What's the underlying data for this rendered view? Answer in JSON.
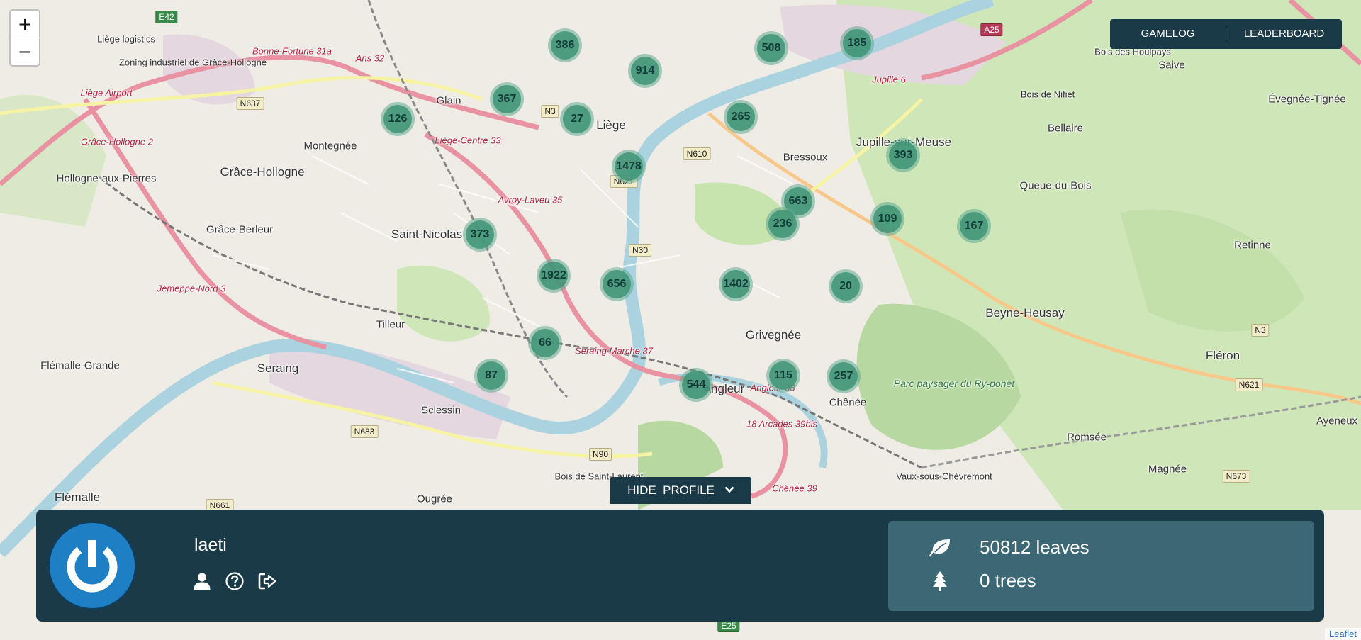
{
  "map": {
    "zoom_in_label": "+",
    "zoom_out_label": "−",
    "attribution": "Leaflet",
    "place_labels": [
      "Liège",
      "Saint-Nicolas",
      "Seraing",
      "Grâce-Hollogne",
      "Grâce-Berleur",
      "Montegnée",
      "Glain",
      "Tilleur",
      "Flémalle-Grande",
      "Flémalle",
      "Ougrée",
      "Sclessin",
      "Grivegnée",
      "Angleur",
      "Bressoux",
      "Jupille-sur-Meuse",
      "Beyne-Heusay",
      "Fléron",
      "Chênée",
      "Queue-du-Bois",
      "Bellaire",
      "Retinne",
      "Saive",
      "Évegnée-Tignée",
      "Romsée",
      "Magnée",
      "Vaux-sous-Chèvremont",
      "Hollogne-aux-Pierres",
      "Ayeneux",
      "Zoning industriel de Grâce-Hollogne",
      "Liège logistics",
      "Liège Airport",
      "Bois de Saint-Laurent",
      "Bois des Houlpays",
      "Bois de Nifiet"
    ],
    "exit_labels": [
      "Bonne-Fortune 31a",
      "Ans 32",
      "Liège-Centre 33",
      "Avroy-Laveu 35",
      "Jemeppe-Nord 3",
      "Seraing Marche 37",
      "Angleur 38",
      "18 Arcades 39bis",
      "Chênée 39",
      "Jupille 6",
      "Grâce-Hollogne 2"
    ],
    "park_label": "Parc paysager du Ry-ponet",
    "road_shields": [
      "E42",
      "N3",
      "N637",
      "N610",
      "N621",
      "N30",
      "N683",
      "N90",
      "N661",
      "E25",
      "A25",
      "N673",
      "N621",
      "N3"
    ],
    "clusters": [
      {
        "count": "386"
      },
      {
        "count": "914"
      },
      {
        "count": "508"
      },
      {
        "count": "185"
      },
      {
        "count": "367"
      },
      {
        "count": "27"
      },
      {
        "count": "126"
      },
      {
        "count": "265"
      },
      {
        "count": "1478"
      },
      {
        "count": "393"
      },
      {
        "count": "663"
      },
      {
        "count": "236"
      },
      {
        "count": "109"
      },
      {
        "count": "167"
      },
      {
        "count": "373"
      },
      {
        "count": "1922"
      },
      {
        "count": "656"
      },
      {
        "count": "1402"
      },
      {
        "count": "20"
      },
      {
        "count": "66"
      },
      {
        "count": "87"
      },
      {
        "count": "544"
      },
      {
        "count": "115"
      },
      {
        "count": "257"
      }
    ]
  },
  "nav": {
    "gamelog": "GAMELOG",
    "leaderboard": "LEADERBOARD"
  },
  "profile": {
    "toggle_label": "HIDE  PROFILE",
    "username": "laeti",
    "leaves": "50812 leaves",
    "trees": "0 trees"
  },
  "colors": {
    "panel": "#1b3a48",
    "stats_box": "#3c6875",
    "cluster_outer": "#60aa91",
    "cluster_inner": "#3e9476",
    "avatar_blue": "#1f7fc4"
  },
  "icons": [
    "leaf-icon",
    "tree-icon",
    "user-icon",
    "help-icon",
    "logout-icon",
    "power-icon",
    "chevron-down-icon"
  ]
}
